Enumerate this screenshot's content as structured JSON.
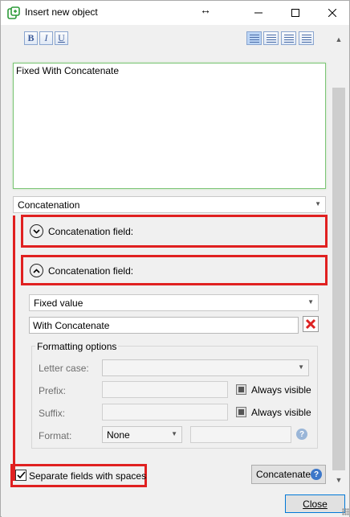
{
  "window": {
    "title": "Insert new object",
    "resize_glyph": "↔",
    "minimize_glyph": "—",
    "maximize_glyph": "☐",
    "close_glyph": "✕"
  },
  "toolbar": {
    "bold": "B",
    "italic": "I",
    "underline": "U",
    "alignments": [
      "align-left",
      "align-center",
      "align-right",
      "align-justify"
    ],
    "active_alignment": "align-left"
  },
  "editor": {
    "content": "Fixed With Concatenate"
  },
  "type_combo": {
    "value": "Concatenation"
  },
  "sections": [
    {
      "label": "Concatenation field:",
      "state": "collapsed",
      "icon": "chevron-down-icon"
    },
    {
      "label": "Concatenation field:",
      "state": "expanded",
      "icon": "chevron-up-icon"
    }
  ],
  "field": {
    "source_combo": "Fixed value",
    "value": "With Concatenate"
  },
  "formatting": {
    "title": "Formatting options",
    "letter_case_label": "Letter case:",
    "letter_case_value": "",
    "prefix_label": "Prefix:",
    "prefix_value": "",
    "prefix_always_visible": "Always visible",
    "suffix_label": "Suffix:",
    "suffix_value": "",
    "suffix_always_visible": "Always visible",
    "format_label": "Format:",
    "format_value": "None",
    "format_extra": ""
  },
  "footer": {
    "separate_label": "Separate fields with spaces",
    "separate_checked": true,
    "concatenate_label": "Concatenate",
    "close_label": "Close"
  },
  "colors": {
    "highlight": "#e02020",
    "editor_border": "#7cc576",
    "accent": "#0078d7"
  }
}
